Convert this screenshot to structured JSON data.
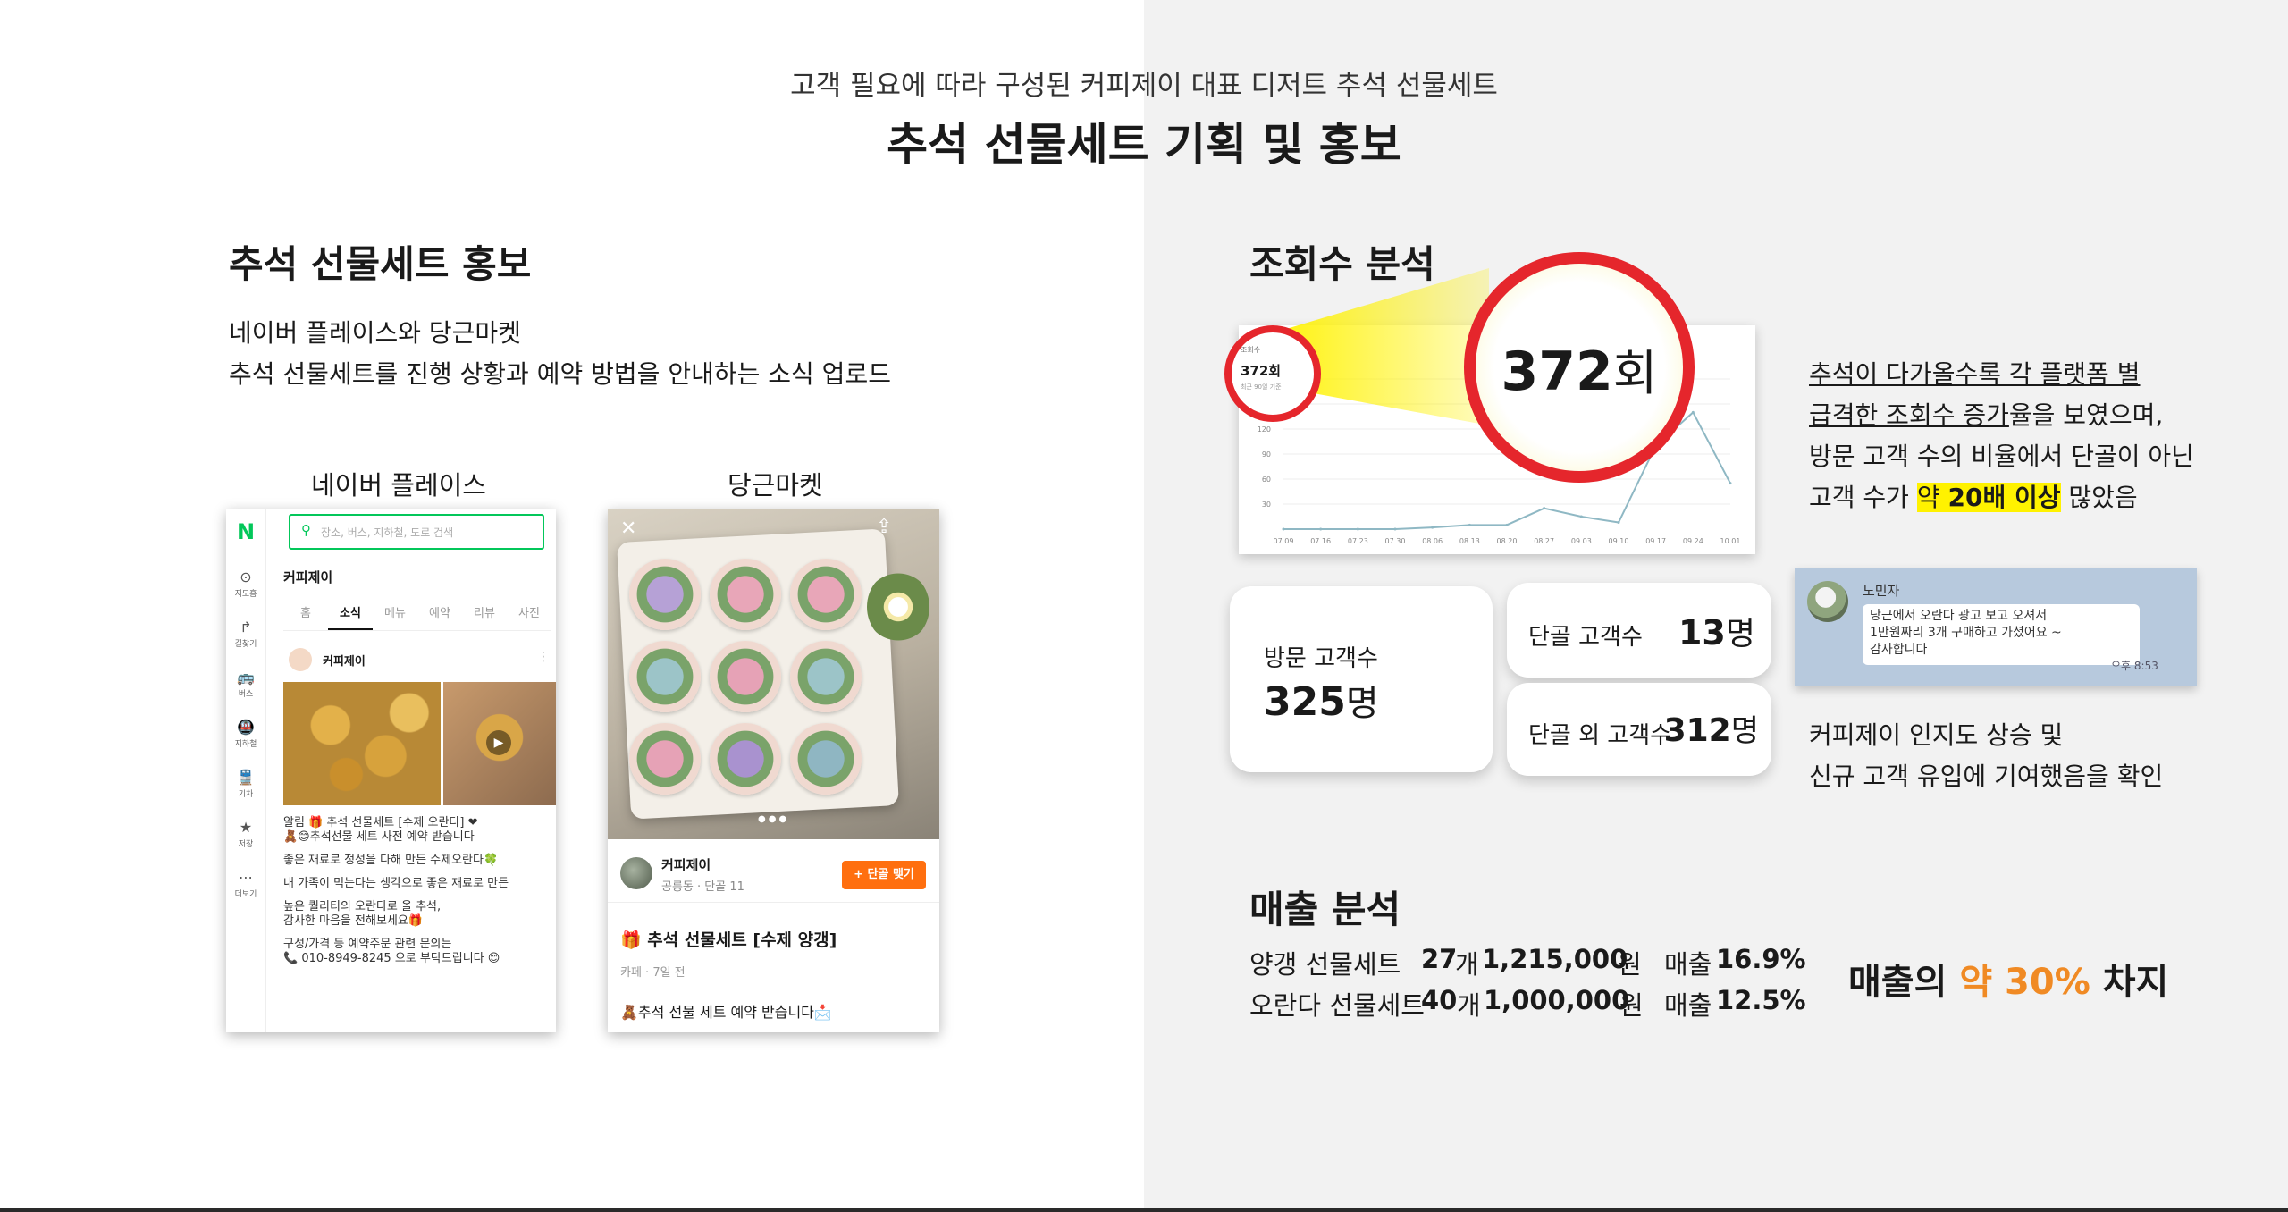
{
  "header": {
    "subtitle": "고객 필요에 따라 구성된 커피제이 대표 디저트 추석 선물세트",
    "title": "추석 선물세트 기획 및 홍보"
  },
  "promo": {
    "heading": "추석 선물세트 홍보",
    "desc_line1": "네이버 플레이스와 당근마켓",
    "desc_line2": "추석 선물세트를 진행 상황과 예약 방법을 안내하는 소식 업로드",
    "naver_label": "네이버 플레이스",
    "daangn_label": "당근마켓"
  },
  "naver_phone": {
    "logo": "N",
    "search_placeholder": "장소, 버스, 지하철, 도로 검색",
    "side_items": [
      "지도홈",
      "길찾기",
      "버스",
      "지하철",
      "기차",
      "저장",
      "더보기"
    ],
    "place_name": "커피제이",
    "tabs": [
      "홈",
      "소식",
      "메뉴",
      "예약",
      "리뷰",
      "사진"
    ],
    "active_tab": "소식",
    "post_author": "커피제이",
    "post_lines": [
      "알림 🎁 추석 선물세트 [수제 오란다] ❤",
      "🧸😊추석선물 세트 사전 예약 받습니다",
      "",
      "좋은 재료로 정성을 다해 만든 수제오란다🍀",
      "",
      "내 가족이 먹는다는 생각으로 좋은 재료로 만든",
      "",
      "높은 퀄리티의 오란다로 올 추석,",
      "감사한 마음을 전해보세요🎁",
      "",
      "구성/가격 등 예약주문 관련 문의는",
      "📞 010-8949-8245 으로 부탁드립니다 😊"
    ]
  },
  "daangn_phone": {
    "close_symbol": "✕",
    "author": "커피제이",
    "author_meta": "공릉동 · 단골 11",
    "follow_button": "+ 단골 맺기",
    "post_title": "🎁 추석 선물세트 [수제 양갱]",
    "post_meta": "카페 · 7일 전",
    "post_body": "🧸추석 선물 세트 예약 받습니다📩"
  },
  "views": {
    "heading": "조회수 분석",
    "mini_label": "조회수",
    "mini_value": "372회",
    "mini_sub": "최근 90일 기준",
    "big_value": "372",
    "big_unit": "회",
    "y_ticks": [
      "180",
      "150",
      "120",
      "90",
      "60",
      "30"
    ],
    "x_ticks": [
      "07.09",
      "07.16",
      "07.23",
      "07.30",
      "08.06",
      "08.13",
      "08.20",
      "08.27",
      "09.03",
      "09.10",
      "09.17",
      "09.24",
      "10.01"
    ],
    "desc_line1": "추석이 다가올수록 각 플랫폼 별",
    "desc_line2a": "급격한 조회수 증가",
    "desc_line2b": "율을 보였으며,",
    "desc_line3": "방문 고객 수의 비율에서 단골이 아닌",
    "desc_line4a": "고객 수가 ",
    "desc_line4b": "약 ",
    "desc_line4c": "20배 이상",
    "desc_line4d": " 많았음"
  },
  "chart_data": {
    "type": "line",
    "title": "",
    "x": [
      "07.09",
      "07.16",
      "07.23",
      "07.30",
      "08.06",
      "08.13",
      "08.20",
      "08.27",
      "09.03",
      "09.10",
      "09.17",
      "09.24",
      "10.01"
    ],
    "series": [
      {
        "values": [
          0,
          0,
          0,
          0,
          2,
          5,
          5,
          25,
          15,
          8,
          100,
          140,
          55
        ]
      }
    ],
    "ylim": [
      0,
      180
    ],
    "xlabel": "",
    "ylabel": "",
    "grid": true,
    "line_color": "#8fb8c4"
  },
  "customers": {
    "visit_label": "방문 고객수",
    "visit_value": "325",
    "visit_unit": "명",
    "regular_label": "단골 고객수",
    "regular_value": "13",
    "regular_unit": "명",
    "other_label": "단골 외 고객수",
    "other_value": "312",
    "other_unit": "명"
  },
  "chat": {
    "name": "노민자",
    "message_line1": "당근에서 오란다 광고 보고 오셔서",
    "message_line2": "1만원짜리 3개 구매하고 가셨어요 ~",
    "message_line3": "감사합니다",
    "time": "오후 8:53",
    "confirm_line1": "커피제이 인지도 상승 및",
    "confirm_line2": "신규 고객 유입에 기여했음을 확인"
  },
  "sales": {
    "heading": "매출 분석",
    "rows": [
      {
        "name": "양갱 선물세트",
        "qty": "27",
        "qty_unit": "개",
        "amount": "1,215,000",
        "amount_unit": "원",
        "ratio_label": "매출",
        "ratio": "16.9%"
      },
      {
        "name": "오란다 선물세트",
        "qty": "40",
        "qty_unit": "개",
        "amount": "1,000,000",
        "amount_unit": "원",
        "ratio_label": "매출",
        "ratio": "12.5%"
      }
    ],
    "share_pre": "매출의 ",
    "share_highlight": "약 30%",
    "share_post": " 차지",
    "highlight_color": "#f08a24"
  },
  "colors": {
    "accent_red": "#e5262c",
    "highlight_yellow": "#fff200",
    "naver_green": "#03c75a",
    "daangn_orange": "#ff6f0f",
    "chat_bg": "#b7c9dd"
  }
}
